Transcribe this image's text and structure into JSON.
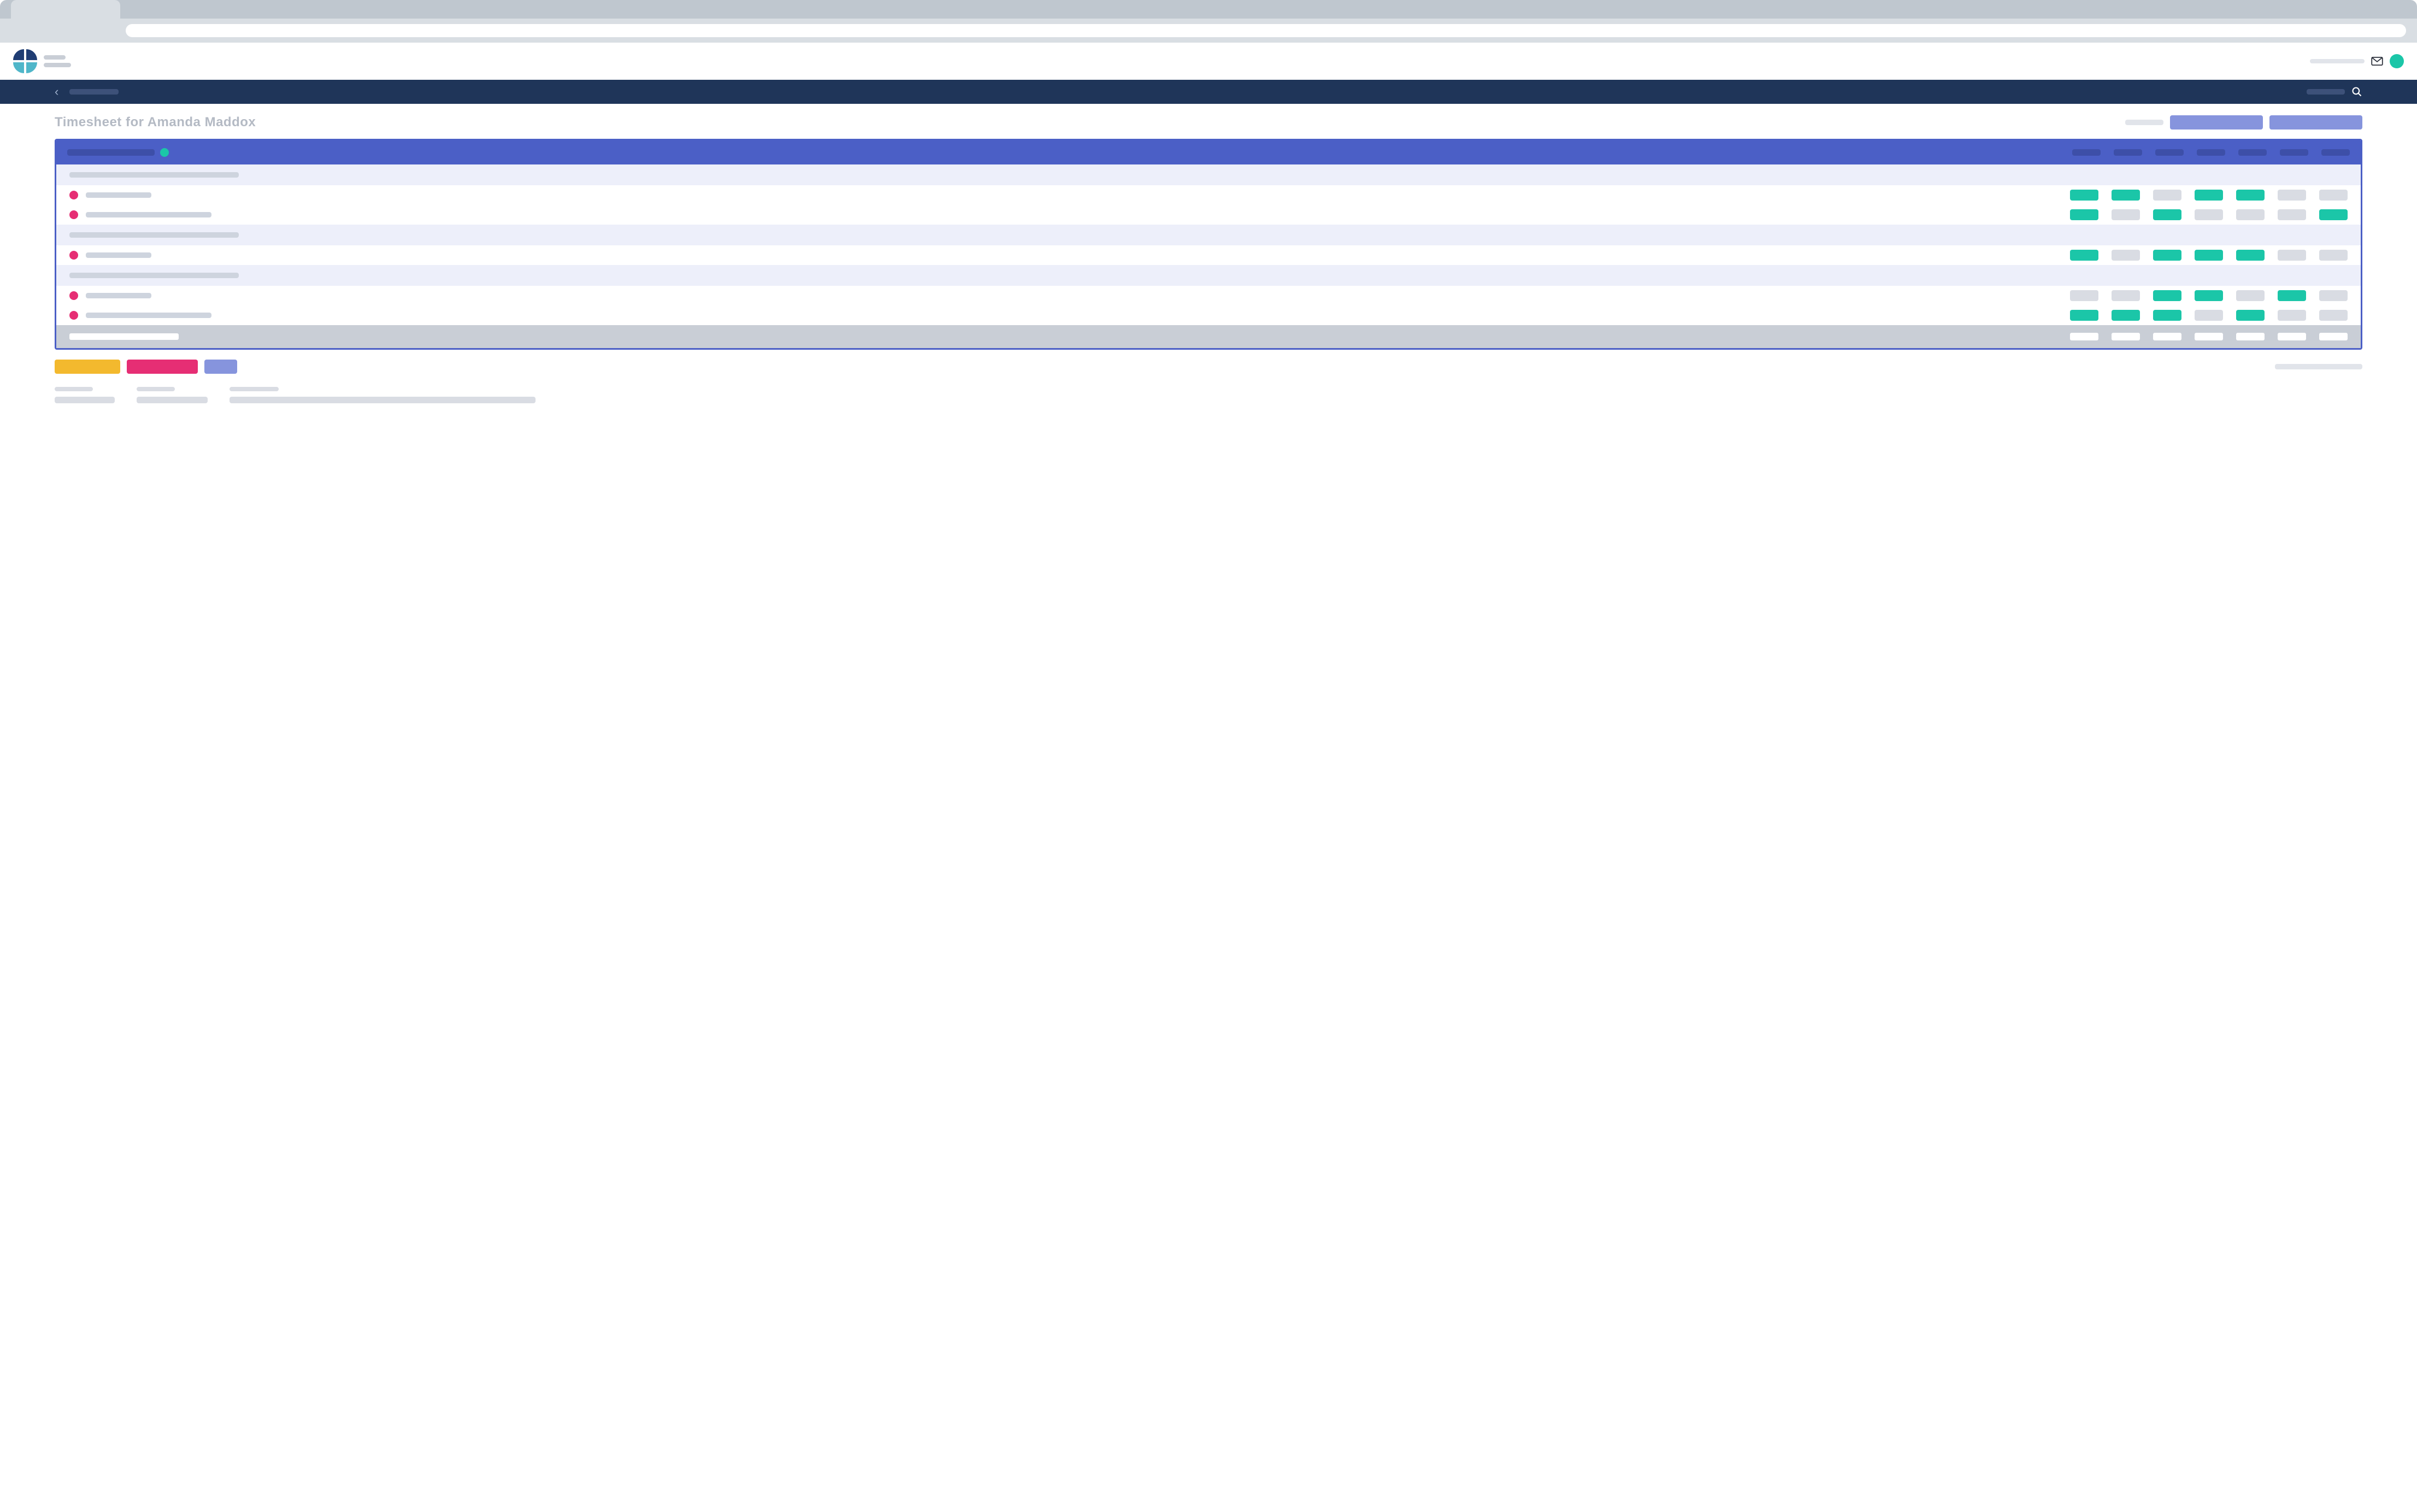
{
  "page_title": "Timesheet for Amanda Maddox",
  "colors": {
    "accent_primary": "#4b5fc6",
    "accent_secondary": "#8694dd",
    "navbar": "#1f3559",
    "status_on": "#1bc6a8",
    "status_off": "#d9dce3",
    "row_marker": "#e62e74",
    "action_yellow": "#f3b92e",
    "action_pink": "#e62e74"
  },
  "icons": {
    "mail": "mail-icon",
    "search": "search-icon",
    "back": "chevron-left-icon"
  },
  "timesheet": {
    "day_columns": 7,
    "sections": [
      {
        "rows": [
          {
            "label_width": 120,
            "cells": [
              "on",
              "on",
              "off",
              "on",
              "on",
              "off",
              "off"
            ]
          },
          {
            "label_width": 230,
            "cells": [
              "on",
              "off",
              "on",
              "off",
              "off",
              "off",
              "on"
            ]
          }
        ]
      },
      {
        "rows": [
          {
            "label_width": 120,
            "cells": [
              "on",
              "off",
              "on",
              "on",
              "on",
              "off",
              "off"
            ]
          }
        ]
      },
      {
        "rows": [
          {
            "label_width": 120,
            "cells": [
              "off",
              "off",
              "on",
              "on",
              "off",
              "on",
              "off"
            ]
          },
          {
            "label_width": 230,
            "cells": [
              "on",
              "on",
              "on",
              "off",
              "on",
              "off",
              "off"
            ]
          }
        ]
      }
    ]
  }
}
